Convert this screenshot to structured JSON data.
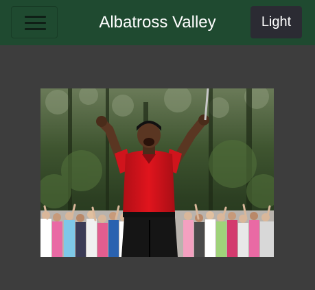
{
  "header": {
    "title": "Albatross Valley",
    "menu_icon": "hamburger-menu-icon",
    "theme_toggle_label": "Light"
  },
  "main": {
    "photo": {
      "subject": "golfer celebrating with arms raised in front of a crowd",
      "colors": {
        "shirt": "#d0141c",
        "trees": "#3a4a2c",
        "crowd": "#e0d8d0"
      }
    }
  }
}
